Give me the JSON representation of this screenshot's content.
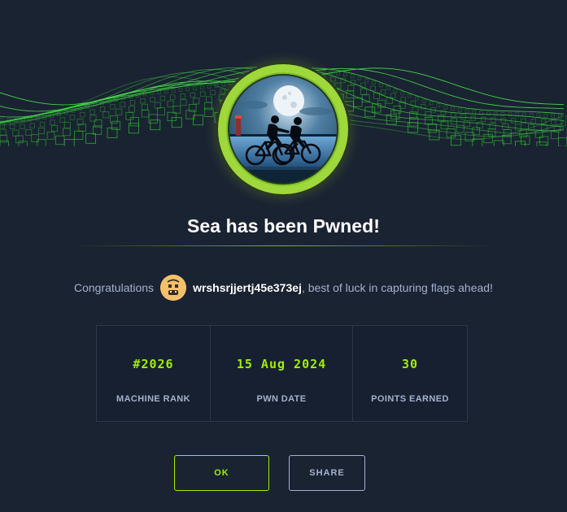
{
  "banner": {
    "graphic": "green-wireframe-wave",
    "accent_color": "#9fef00"
  },
  "machine": {
    "name": "Sea",
    "badge_icon": "cyclists-moonlit-sea-icon",
    "badge_ring_color": "#9fd83a"
  },
  "title": "Sea has been Pwned!",
  "message": {
    "prefix": "Congratulations",
    "avatar_icon": "user-avatar-icon",
    "username": "wrshsrjjertj45e373ej",
    "suffix": ", best of luck in capturing flags ahead!"
  },
  "stats": [
    {
      "value": "#2026",
      "label": "MACHINE RANK"
    },
    {
      "value": "15 Aug 2024",
      "label": "PWN DATE"
    },
    {
      "value": "30",
      "label": "POINTS EARNED"
    }
  ],
  "buttons": {
    "ok_label": "OK",
    "share_label": "SHARE"
  },
  "colors": {
    "background": "#1a2332",
    "accent_green": "#9fef00",
    "muted_text": "#a4b1cd"
  }
}
